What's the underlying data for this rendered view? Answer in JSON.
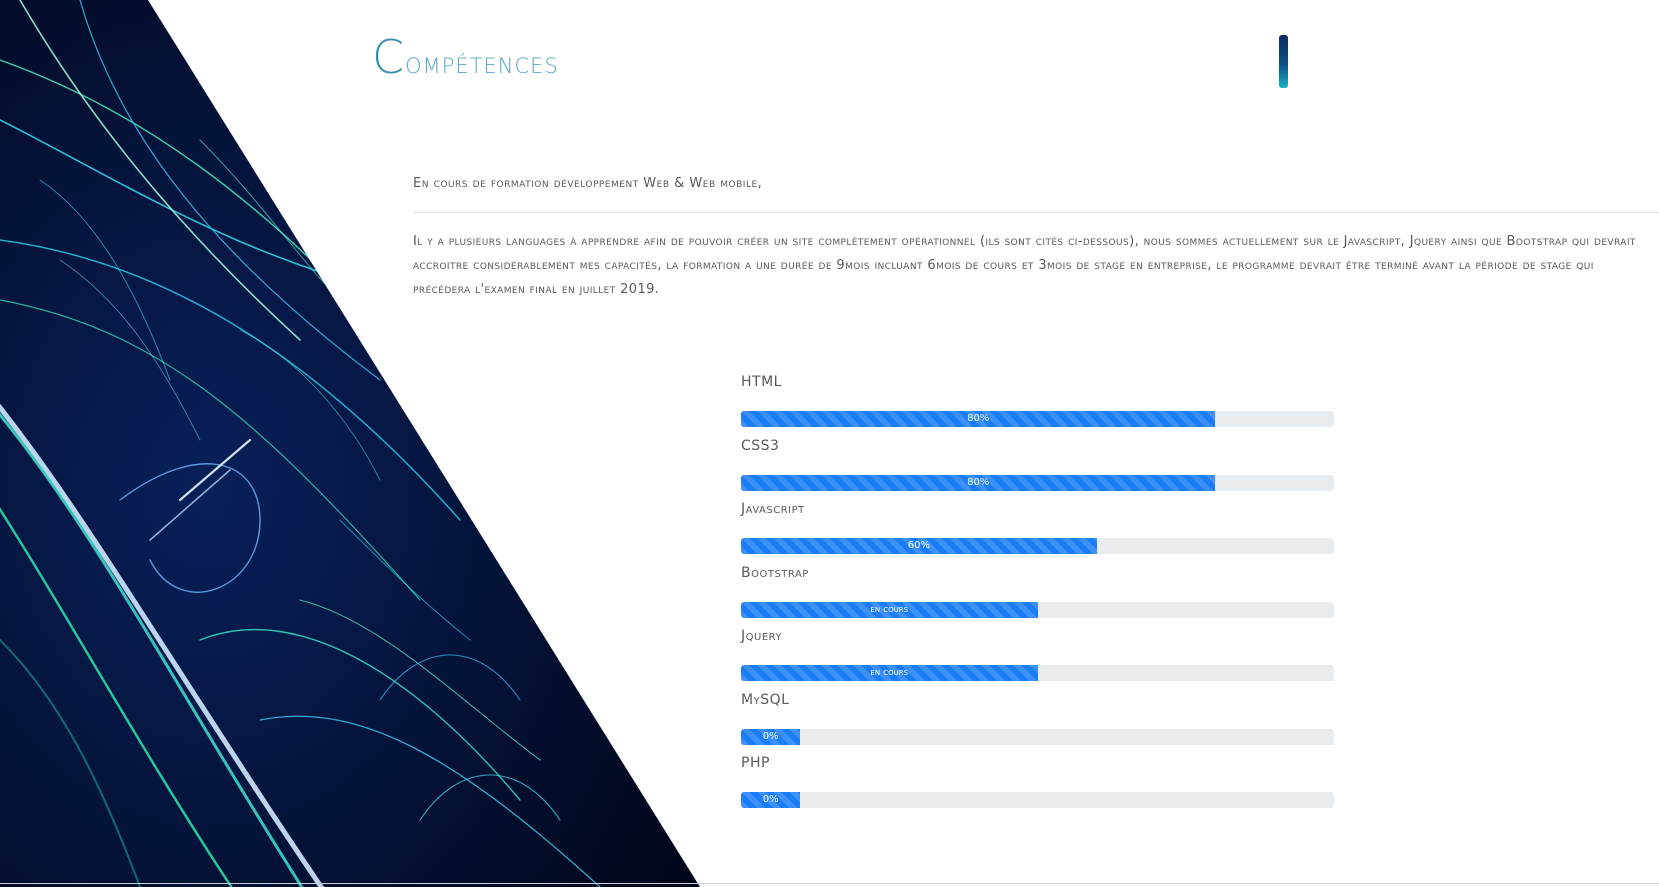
{
  "header": {
    "title_first": "C",
    "title_rest": "ompétences"
  },
  "intro": "En cours de formation développement Web & Web mobile,",
  "description": "Il y a plusieurs languages à apprendre afin de pouvoir créer un site complètement opérationnel (ils sont cités ci-dessous), nous sommes actuellement sur le Javascript, Jquery ainsi que Bootstrap qui devrait accroitre considérablement mes capacités, la formation a une durée de 9mois incluant 6mois de cours et 3mois de stage en entreprise, le programme devrait être terminé avant la période de stage qui précédera l'examen final en juillet 2019.",
  "skills": [
    {
      "name": "HTML",
      "label": "80%",
      "value": 0.8
    },
    {
      "name": "CSS3",
      "label": "80%",
      "value": 0.8
    },
    {
      "name": "Javascript",
      "label": "60%",
      "value": 0.6
    },
    {
      "name": "Bootstrap",
      "label": "en cours",
      "value": 0.5
    },
    {
      "name": "Jquery",
      "label": "en cours",
      "value": 0.5
    },
    {
      "name": "MySQL",
      "label": "0%",
      "value": 0.1
    },
    {
      "name": "PHP",
      "label": "0%",
      "value": 0.1
    }
  ],
  "colors": {
    "accent": "#1a7cf7",
    "track": "#e9ecef",
    "title": "#5aa6c6",
    "text": "#555a60"
  }
}
